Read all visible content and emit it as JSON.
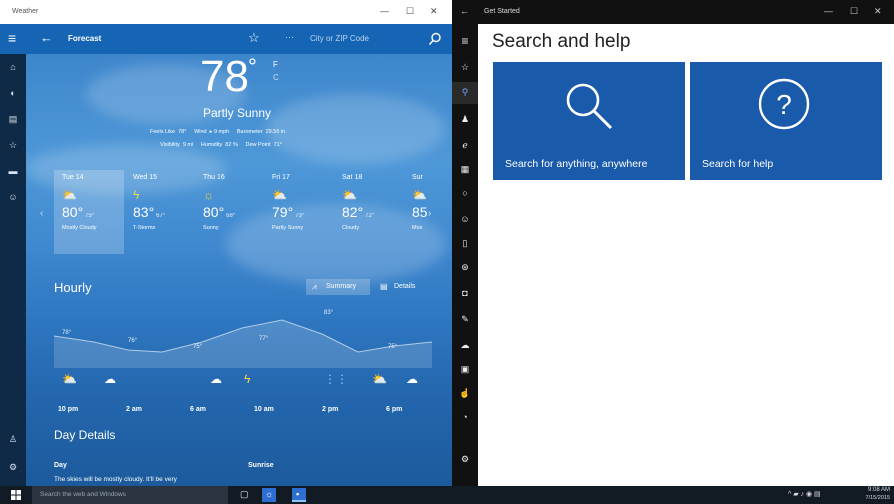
{
  "weather": {
    "window_title": "Weather",
    "nav": {
      "page_title": "Forecast",
      "search_placeholder": "City or ZIP Code"
    },
    "rail_icons": [
      "home-icon",
      "news-icon",
      "chart-icon",
      "star-icon",
      "flag-icon",
      "smile-icon",
      "person-icon",
      "settings-icon"
    ],
    "current": {
      "temp": "78",
      "unit_f": "F",
      "unit_c": "C",
      "condition": "Partly Sunny",
      "details_line1": "Feels Like  78°     Wind  ▸ 9 mph     Barometer  29.56 in",
      "details_line2": "Visibility  9 mi     Humidity  82 %     Dew Point  71°"
    },
    "days": [
      {
        "day": "Tue 14",
        "icon": "⛅",
        "hi": "80°",
        "lo": "75°",
        "cond": "Mostly Cloudy"
      },
      {
        "day": "Wed 15",
        "icon": "ϟ",
        "hi": "83°",
        "lo": "67°",
        "cond": "T-Storms"
      },
      {
        "day": "Thu 16",
        "icon": "☼",
        "hi": "80°",
        "lo": "68°",
        "cond": "Sunny"
      },
      {
        "day": "Fri 17",
        "icon": "⛅",
        "hi": "79°",
        "lo": "73°",
        "cond": "Partly Sunny"
      },
      {
        "day": "Sat 18",
        "icon": "⛅",
        "hi": "82°",
        "lo": "72°",
        "cond": "Cloudy"
      },
      {
        "day": "Sur",
        "icon": "⛅",
        "hi": "85",
        "lo": "",
        "cond": "Mos"
      }
    ],
    "hourly": {
      "title": "Hourly",
      "summary_label": "Summary",
      "details_label": "Details",
      "temps": [
        "78°",
        "76°",
        "75°",
        "77°",
        "83°",
        "75°"
      ],
      "times": [
        "10 pm",
        "2 am",
        "6 am",
        "10 am",
        "2 pm",
        "6 pm"
      ]
    },
    "day_details": {
      "title": "Day Details",
      "day_label": "Day",
      "day_text": "The skies will be mostly cloudy. It'll be very",
      "sunrise_label": "Sunrise"
    }
  },
  "get_started": {
    "window_title": "Get Started",
    "heading": "Search and help",
    "tiles": [
      {
        "label": "Search for anything, anywhere"
      },
      {
        "label": "Search for help"
      }
    ]
  },
  "taskbar": {
    "search_placeholder": "Search the web and Windows",
    "clock_time": "9:08 AM",
    "clock_date": "7/15/2015"
  },
  "colors": {
    "weather_nav": "#1565b4",
    "tile_blue": "#1a5aaa",
    "taskbar": "#121a24"
  }
}
